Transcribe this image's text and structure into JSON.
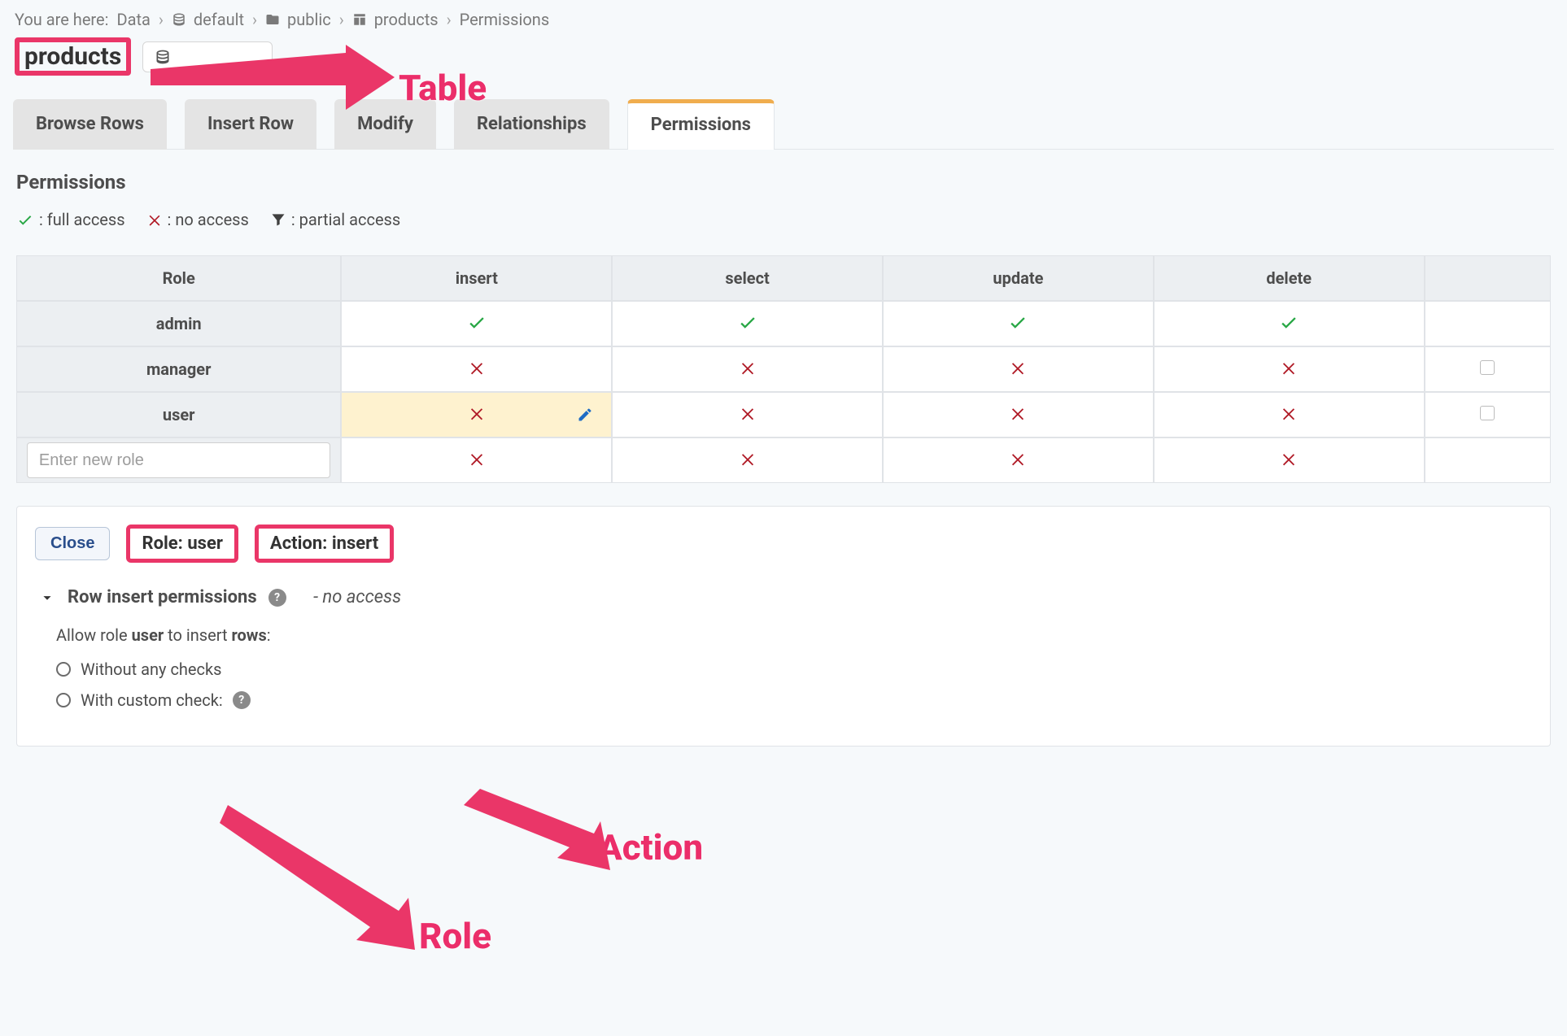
{
  "breadcrumb": {
    "prefix": "You are here:",
    "root": "Data",
    "db": "default",
    "schema": "public",
    "table": "products",
    "leaf": "Permissions"
  },
  "title": "products",
  "tabs": [
    "Browse Rows",
    "Insert Row",
    "Modify",
    "Relationships",
    "Permissions"
  ],
  "activeTab": "Permissions",
  "section": "Permissions",
  "legend": {
    "full": ": full access",
    "none": ": no access",
    "partial": ": partial access"
  },
  "table": {
    "head": {
      "role": "Role",
      "cols": [
        "insert",
        "select",
        "update",
        "delete"
      ]
    },
    "rows": [
      {
        "role": "admin",
        "cells": [
          "check",
          "check",
          "check",
          "check"
        ],
        "checkbox": false
      },
      {
        "role": "manager",
        "cells": [
          "cross",
          "cross",
          "cross",
          "cross"
        ],
        "checkbox": true
      },
      {
        "role": "user",
        "cells": [
          "cross-sel",
          "cross",
          "cross",
          "cross"
        ],
        "checkbox": true
      }
    ],
    "newRolePlaceholder": "Enter new role",
    "newRoleCells": [
      "cross",
      "cross",
      "cross",
      "cross"
    ]
  },
  "editor": {
    "close": "Close",
    "role_label": "Role: user",
    "action_label": "Action: insert",
    "sub_head": "Row insert permissions",
    "status": "- no access",
    "allow_prefix": "Allow role ",
    "allow_role": "user",
    "allow_mid": " to insert ",
    "allow_obj": "rows",
    "options": [
      "Without any checks",
      "With custom check:"
    ]
  },
  "annotations": {
    "table": "Table",
    "action": "Action",
    "role": "Role"
  }
}
